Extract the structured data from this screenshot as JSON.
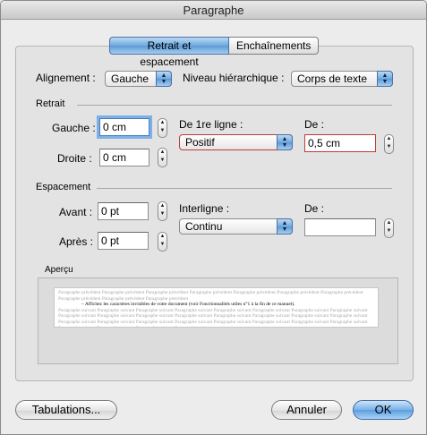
{
  "window": {
    "title": "Paragraphe"
  },
  "tabs": [
    {
      "label": "Retrait et espacement"
    },
    {
      "label": "Enchaînements"
    }
  ],
  "alignement": {
    "label": "Alignement :",
    "value": "Gauche"
  },
  "niveau": {
    "label": "Niveau hiérarchique :",
    "value": "Corps de texte"
  },
  "retrait": {
    "title": "Retrait",
    "gauche_label": "Gauche :",
    "gauche_value": "0 cm",
    "droite_label": "Droite :",
    "droite_value": "0 cm",
    "premiere_label": "De 1re ligne :",
    "premiere_value": "Positif",
    "de_label": "De :",
    "de_value": "0,5 cm"
  },
  "espacement": {
    "title": "Espacement",
    "avant_label": "Avant :",
    "avant_value": "0 pt",
    "apres_label": "Après :",
    "apres_value": "0 pt",
    "interligne_label": "Interligne :",
    "interligne_value": "Continu",
    "de_label": "De :",
    "de_value": ""
  },
  "apercu": {
    "title": "Aperçu",
    "before": "Paragraphe précédent Paragraphe précédent Paragraphe précédent Paragraphe précédent Paragraphe précédent Paragraphe précédent Paragraphe précédent Paragraphe précédent Paragraphe précédent Paragraphe précédent",
    "main": "– Affichez les caractères invisibles de votre document (voir Fonctionnalités utiles n°1 à la fin de ce manuel).",
    "after": "Paragraphe suivant Paragraphe suivant Paragraphe suivant Paragraphe suivant Paragraphe suivant Paragraphe suivant Paragraphe suivant Paragraphe suivant Paragraphe suivant Paragraphe suivant Paragraphe suivant Paragraphe suivant Paragraphe suivant Paragraphe suivant Paragraphe suivant Paragraphe suivant Paragraphe suivant Paragraphe suivant Paragraphe suivant Paragraphe suivant Paragraphe suivant Paragraphe suivant Paragraphe suivant Paragraphe suivant Paragraphe suivant Paragraphe suivant Paragraphe suivant Paragraphe suivant"
  },
  "buttons": {
    "tabulations": "Tabulations...",
    "annuler": "Annuler",
    "ok": "OK"
  },
  "icons": {
    "popup_arrow": "updown-arrows-icon",
    "stepper": "stepper-arrows-icon"
  }
}
